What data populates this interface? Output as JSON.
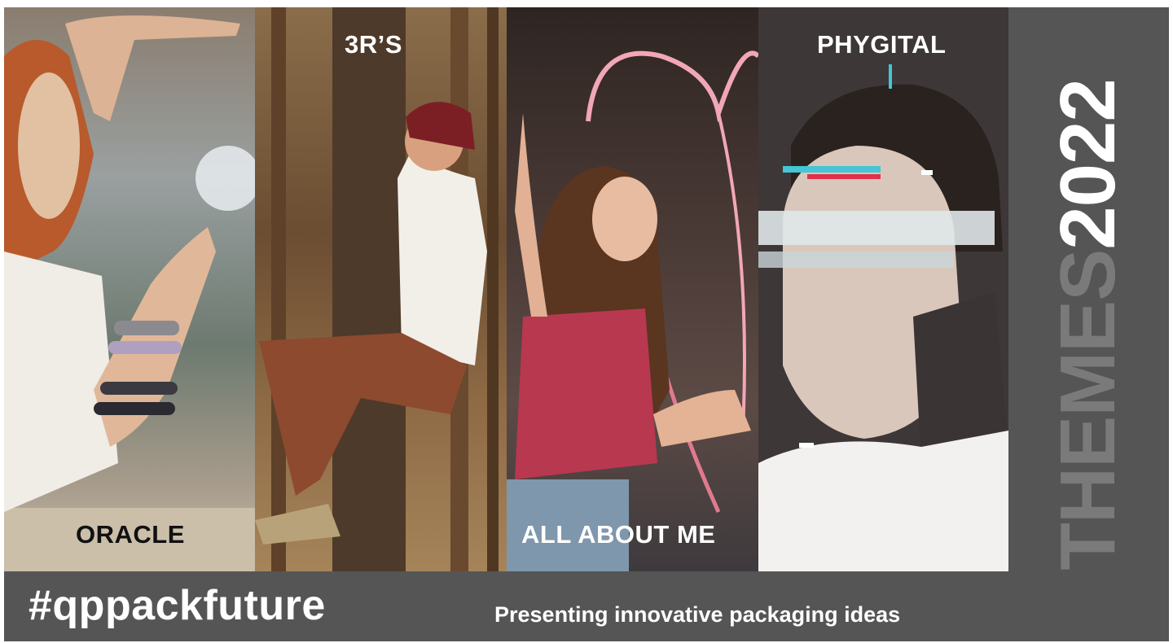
{
  "panels": [
    {
      "label": "ORACLE"
    },
    {
      "label": "3R’S"
    },
    {
      "label": "ALL ABOUT ME"
    },
    {
      "label": "PHYGITAL"
    }
  ],
  "footer": {
    "hashtag": "#qppackfuture",
    "tagline": "Presenting innovative packaging ideas"
  },
  "side": {
    "title_part1": "THEMES",
    "title_part2": "2022"
  },
  "colors": {
    "bar": "#555555",
    "themes_text": "#7a7a7a",
    "year_text": "#ffffff"
  }
}
